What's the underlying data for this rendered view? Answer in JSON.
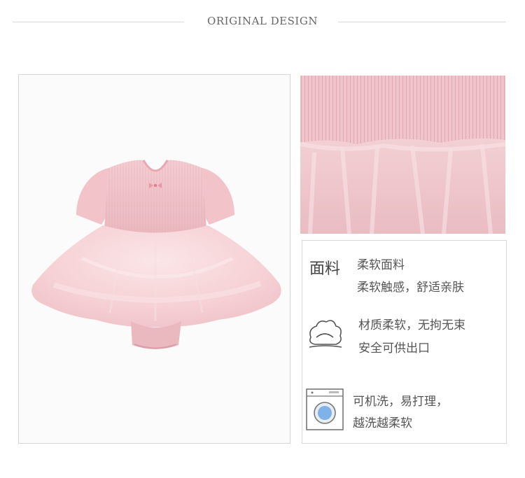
{
  "header": {
    "title": "ORIGINAL DESIGN"
  },
  "product_image": {
    "icon": "pink-tutu-romper-image"
  },
  "detail_image": {
    "icon": "fabric-detail-image"
  },
  "features": {
    "fabric": {
      "title": "面料",
      "line1": "柔软面料",
      "line2": "柔软触感，舒适亲肤"
    },
    "soft": {
      "icon": "soft-fabric-icon",
      "line1": "材质柔软，无拘无束",
      "line2": "安全可供出口"
    },
    "washable": {
      "icon": "washing-machine-icon",
      "line1": "可机洗，易打理，",
      "line2": "越洗越柔软"
    }
  },
  "colors": {
    "accent_pink": "#f2c7cd",
    "border": "#d6d6d6"
  }
}
